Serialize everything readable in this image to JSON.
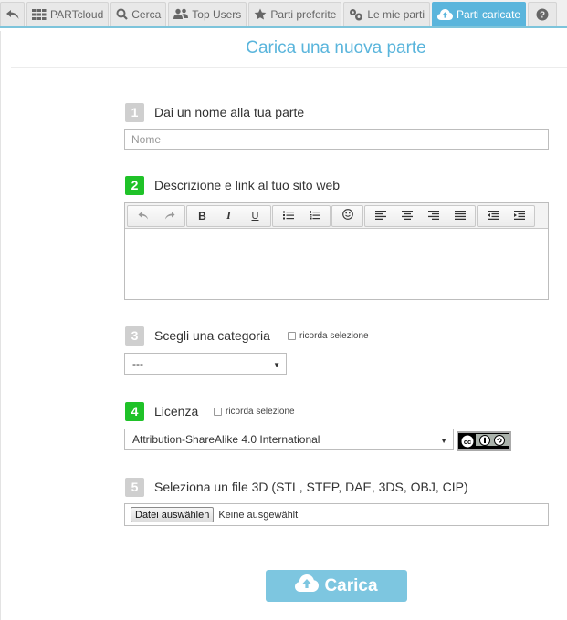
{
  "tabs": {
    "partcloud": "PARTcloud",
    "search": "Cerca",
    "top_users": "Top Users",
    "favorites": "Parti preferite",
    "my_parts": "Le mie parti",
    "uploaded": "Parti caricate"
  },
  "page_title": "Carica una nuova parte",
  "steps": {
    "s1": {
      "number": "1",
      "label": "Dai un nome alla tua parte",
      "placeholder": "Nome"
    },
    "s2": {
      "number": "2",
      "label": "Descrizione e link al tuo sito web"
    },
    "s3": {
      "number": "3",
      "label": "Scegli una categoria",
      "remember": "ricorda selezione",
      "selected": "---"
    },
    "s4": {
      "number": "4",
      "label": "Licenza",
      "remember": "ricorda selezione",
      "selected": "Attribution-ShareAlike 4.0 International"
    },
    "s5": {
      "number": "5",
      "label": "Seleziona un file 3D (STL, STEP, DAE, 3DS, OBJ, CIP)",
      "file_button": "Datei auswählen",
      "file_status": "Keine ausgewählt"
    }
  },
  "toolbar": {
    "bold": "B",
    "italic": "I",
    "underline": "U"
  },
  "submit_label": "Carica",
  "colors": {
    "accent": "#5ab5dc",
    "active_step": "#1fc228",
    "inactive_step": "#cfcfcf",
    "button": "#7dc6e0"
  },
  "icons": {
    "tabs": [
      "back-arrow-icon",
      "grid-icon",
      "magnifier-icon",
      "users-icon",
      "star-icon",
      "parts-icon",
      "cloud-upload-icon",
      "help-icon"
    ],
    "toolbar": [
      "undo-icon",
      "redo-icon",
      "unordered-list-icon",
      "ordered-list-icon",
      "emoticon-icon",
      "align-left-icon",
      "align-center-icon",
      "align-right-icon",
      "align-justify-icon",
      "outdent-icon",
      "indent-icon"
    ],
    "license": "cc-by-sa-icon"
  }
}
